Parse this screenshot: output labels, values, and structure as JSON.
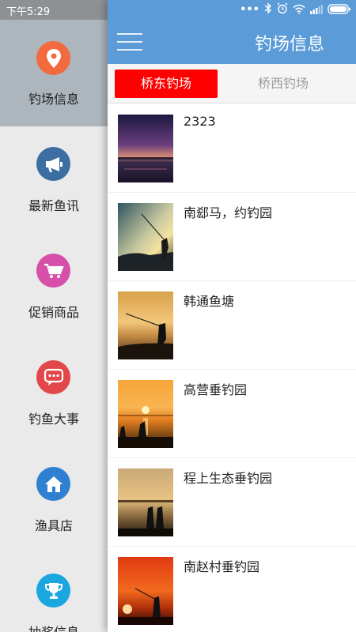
{
  "status_bar": {
    "time": "下午5:29",
    "dots": "•••"
  },
  "app_bar": {
    "title": "钓场信息"
  },
  "drawer": {
    "items": [
      {
        "label": "钓场信息",
        "icon": "location-pin-icon",
        "color": "#f26a3e",
        "active": true
      },
      {
        "label": "最新鱼讯",
        "icon": "megaphone-icon",
        "color": "#3c6da3",
        "active": false
      },
      {
        "label": "促销商品",
        "icon": "shopping-cart-icon",
        "color": "#d64fa8",
        "active": false
      },
      {
        "label": "钓鱼大事",
        "icon": "chat-bubble-icon",
        "color": "#e2484b",
        "active": false
      },
      {
        "label": "渔具店",
        "icon": "home-icon",
        "color": "#2f80d1",
        "active": false
      },
      {
        "label": "抽奖信息",
        "icon": "trophy-icon",
        "color": "#1aa7e0",
        "active": false
      }
    ]
  },
  "tabs": [
    {
      "label": "桥东钓场",
      "active": true
    },
    {
      "label": "桥西钓场",
      "active": false
    }
  ],
  "fishing_spots": [
    {
      "name": "2323",
      "thumb": "dusk-lake-photo"
    },
    {
      "name": "南郄马，约钓园",
      "thumb": "angler-silhouette-photo"
    },
    {
      "name": "韩通鱼塘",
      "thumb": "sunset-fishing-photo"
    },
    {
      "name": "高营垂钓园",
      "thumb": "orange-sunset-photo"
    },
    {
      "name": "程上生态垂钓园",
      "thumb": "couple-silhouette-photo"
    },
    {
      "name": "南赵村垂钓园",
      "thumb": "red-sunset-photo"
    }
  ],
  "colors": {
    "accent": "#5b9bd8",
    "tab_active": "#ff0000"
  }
}
